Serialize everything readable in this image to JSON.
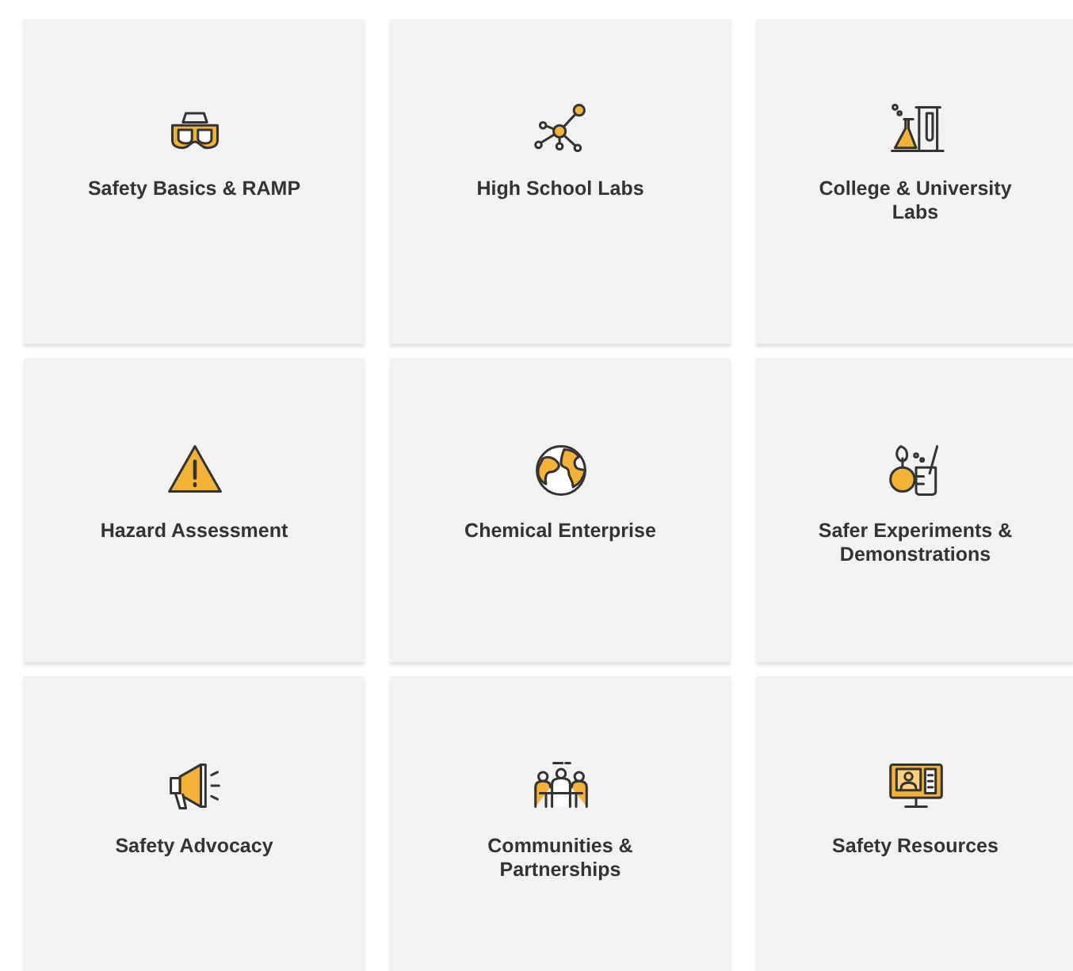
{
  "cards": [
    {
      "title": "Safety Basics & RAMP"
    },
    {
      "title": "High School Labs"
    },
    {
      "title": "College & University Labs"
    },
    {
      "title": "Hazard Assessment"
    },
    {
      "title": "Chemical Enterprise"
    },
    {
      "title": "Safer Experiments & Demonstrations"
    },
    {
      "title": "Safety Advocacy"
    },
    {
      "title": "Communities & Partnerships"
    },
    {
      "title": "Safety Resources"
    }
  ]
}
